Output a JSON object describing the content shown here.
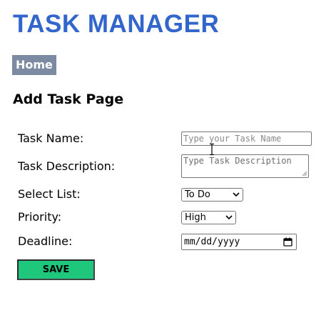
{
  "app": {
    "title": "TASK MANAGER"
  },
  "nav": {
    "home_label": "Home"
  },
  "page": {
    "heading": "Add Task Page"
  },
  "form": {
    "task_name": {
      "label": "Task Name:",
      "value": "",
      "placeholder": "Type your Task Name"
    },
    "task_description": {
      "label": "Task Description:",
      "value": "",
      "placeholder": "Type Task Description"
    },
    "select_list": {
      "label": "Select List:",
      "selected": "To Do"
    },
    "priority": {
      "label": "Priority:",
      "selected": "High"
    },
    "deadline": {
      "label": "Deadline:",
      "value": "mm/dd/yyyy",
      "icon": "calendar-icon"
    },
    "save_label": "SAVE"
  },
  "colors": {
    "title": "#3366cc",
    "nav_bg": "#7c8ba2",
    "save_bg": "#1fc77d"
  }
}
